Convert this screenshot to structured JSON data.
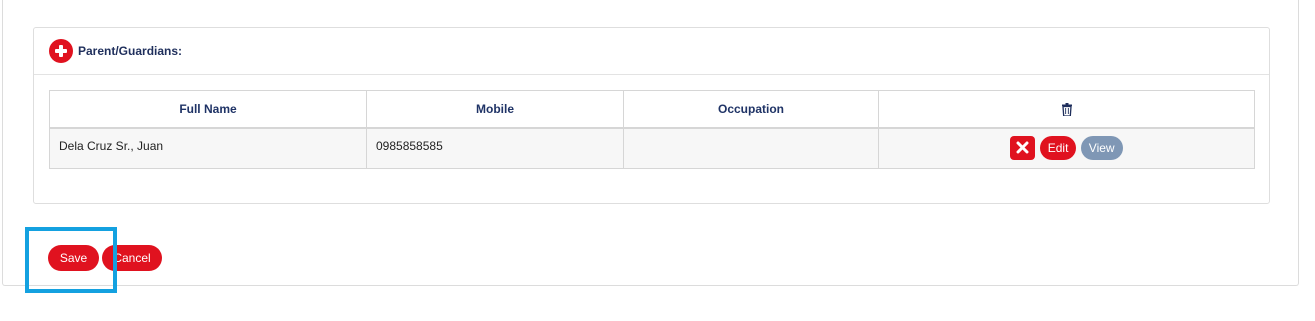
{
  "panel": {
    "title": "Parent/Guardians:"
  },
  "table": {
    "headers": [
      "Full Name",
      "Mobile",
      "Occupation"
    ],
    "delete_column_icon": "trash-icon",
    "rows": [
      {
        "full_name": "Dela Cruz Sr., Juan",
        "mobile": "0985858585",
        "occupation": "",
        "actions": {
          "delete_icon": "x-icon",
          "edit_label": "Edit",
          "view_label": "View"
        }
      }
    ]
  },
  "footer": {
    "save_label": "Save",
    "cancel_label": "Cancel"
  },
  "colors": {
    "accent": "#e0121f",
    "view_button": "#7f97b5",
    "header_text": "#1f3366",
    "selection_highlight": "#14a1e0"
  }
}
